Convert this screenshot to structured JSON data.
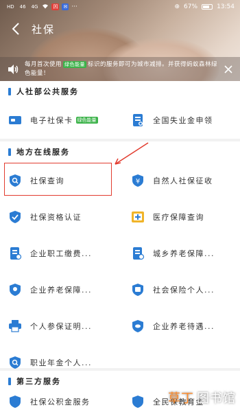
{
  "statusbar": {
    "carrier_chips": [
      "HD",
      "46",
      "4G"
    ],
    "app_chip": "凹",
    "battery": "67%",
    "time": "13:54"
  },
  "navbar": {
    "title": "社保"
  },
  "notice": {
    "text_part1": "每月首次使用",
    "tag": "绿色能量",
    "text_part2": "标识的服务即可为城市减排。并获得蚂蚁森林绿色能量！"
  },
  "sections": [
    {
      "title": "人社部公共服务",
      "items": [
        {
          "label": "电子社保卡",
          "tag": "绿色能量",
          "icon": "card-icon"
        },
        {
          "label": "全国失业金申领",
          "icon": "document-icon"
        }
      ]
    },
    {
      "title": "地方在线服务",
      "items": [
        {
          "label": "社保查询",
          "icon": "search-icon"
        },
        {
          "label": "自然人社保征收",
          "icon": "yuan-shield-icon"
        },
        {
          "label": "社保资格认证",
          "icon": "verify-shield-icon"
        },
        {
          "label": "医疗保障查询",
          "icon": "medical-icon"
        },
        {
          "label": "企业职工缴费...",
          "icon": "document-icon"
        },
        {
          "label": "城乡养老保障...",
          "icon": "document-icon"
        },
        {
          "label": "企业养老保障...",
          "icon": "shield-icon"
        },
        {
          "label": "社会保险个人...",
          "icon": "shield-icon"
        },
        {
          "label": "个人参保证明...",
          "icon": "printer-icon"
        },
        {
          "label": "企业养老待遇...",
          "icon": "shield-icon"
        },
        {
          "label": "职业年金个人...",
          "icon": "search-icon"
        }
      ]
    },
    {
      "title": "第三方服务",
      "items": [
        {
          "label": "社保公积金服务",
          "icon": "shield-icon"
        },
        {
          "label": "全民保教育金",
          "icon": "shield-icon"
        }
      ]
    }
  ],
  "watermark": {
    "accent": "草丁",
    "rest": "图书馆"
  },
  "colors": {
    "primary": "#2b7cd3",
    "highlight": "#e23b2e",
    "green_tag": "#3cb34a"
  }
}
